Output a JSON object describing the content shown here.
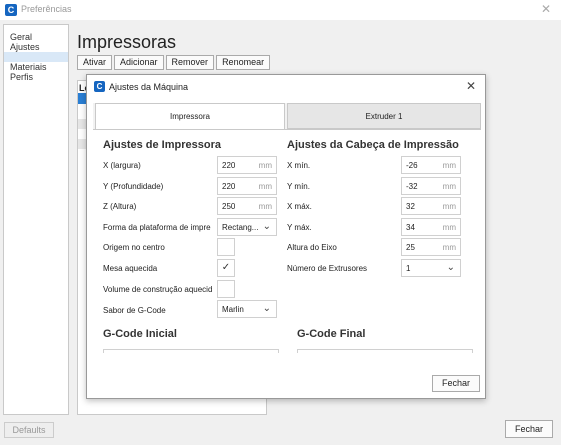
{
  "window": {
    "title": "Preferências",
    "app_icon": "cura-icon",
    "close_icon": "close-icon"
  },
  "sidebar": {
    "items": [
      {
        "label": "Geral"
      },
      {
        "label": "Ajustes"
      },
      {
        "label": "Materiais"
      },
      {
        "label": "Perfis"
      }
    ]
  },
  "page": {
    "heading": "Impressoras",
    "buttons": [
      "Ativar",
      "Adicionar",
      "Remover",
      "Renomear"
    ],
    "list_label": "Lo"
  },
  "footer": {
    "defaults_label": "Defaults",
    "close_label": "Fechar"
  },
  "dialog": {
    "title": "Ajustes da Máquina",
    "tabs": [
      "Impressora",
      "Extruder 1"
    ],
    "printer_settings": {
      "title": "Ajustes de Impressora",
      "x_label": "X (largura)",
      "x_value": "220",
      "x_unit": "mm",
      "y_label": "Y (Profundidade)",
      "y_value": "220",
      "y_unit": "mm",
      "z_label": "Z (Altura)",
      "z_value": "250",
      "z_unit": "mm",
      "plate_label": "Forma da plataforma de impre",
      "plate_value": "Rectang...",
      "origin_label": "Origem no centro",
      "origin_checked": false,
      "heated_bed_label": "Mesa aquecida",
      "heated_bed_checked": true,
      "heated_volume_label": "Volume de construção aquecid",
      "heated_volume_checked": false,
      "gcode_flavor_label": "Sabor de G-Code",
      "gcode_flavor_value": "Marlin"
    },
    "head_settings": {
      "title": "Ajustes da Cabeça de Impressão",
      "xmin_label": "X mín.",
      "xmin_value": "-26",
      "xmin_unit": "mm",
      "ymin_label": "Y mín.",
      "ymin_value": "-32",
      "ymin_unit": "mm",
      "xmax_label": "X máx.",
      "xmax_value": "32",
      "xmax_unit": "mm",
      "ymax_label": "Y máx.",
      "ymax_value": "34",
      "ymax_unit": "mm",
      "gantry_label": "Altura do Eixo",
      "gantry_value": "25",
      "gantry_unit": "mm",
      "extruders_label": "Número de Extrusores",
      "extruders_value": "1"
    },
    "gcode": {
      "start_title": "G-Code Inicial",
      "end_title": "G-Code Final"
    },
    "close_label": "Fechar"
  }
}
